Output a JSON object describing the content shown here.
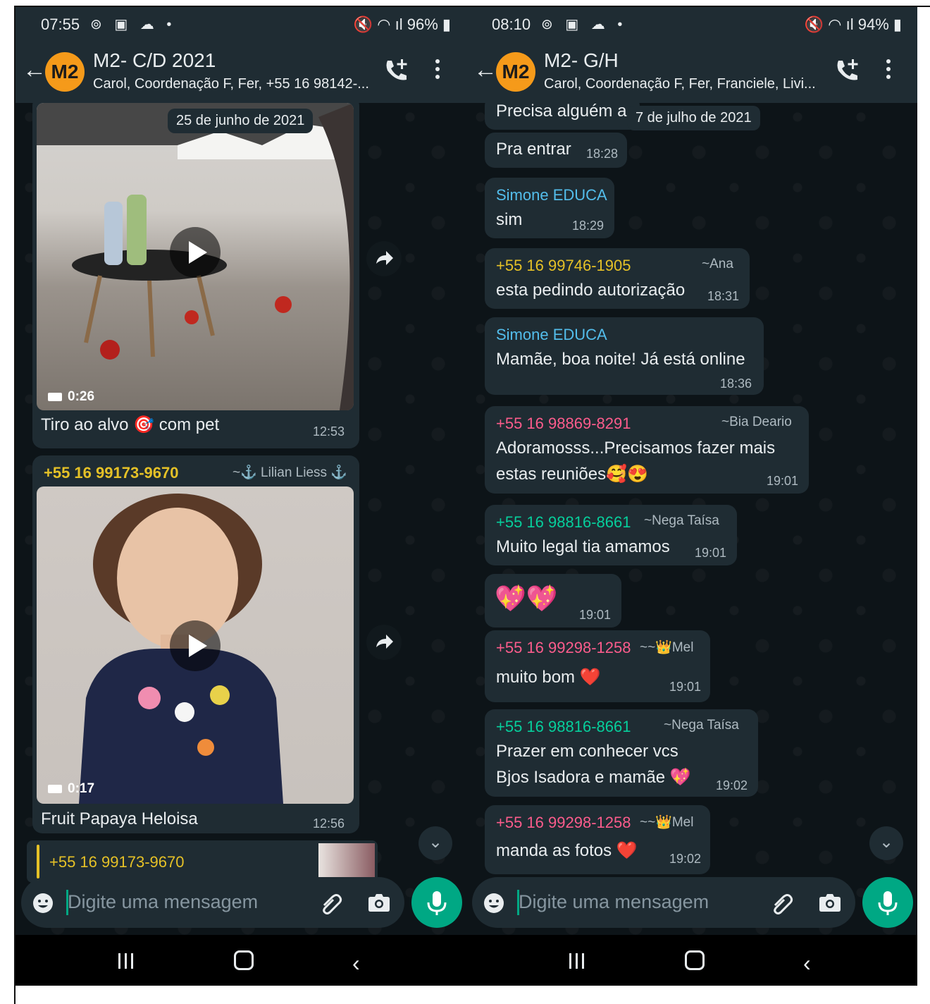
{
  "left": {
    "status": {
      "time": "07:55",
      "battery": "96%"
    },
    "header": {
      "title": "M2- C/D 2021",
      "subtitle": "Carol, Coordenação F, Fer, +55 16 98142-...",
      "avatar": "M2"
    },
    "date_chip": "25 de junho de 2021",
    "video1": {
      "duration": "0:26",
      "caption_a": "Tiro ao alvo",
      "caption_b": "com pet",
      "time": "12:53"
    },
    "video2": {
      "sender": "+55 16 99173-9670",
      "alias": "~⚓ Lilian Liess ⚓",
      "duration": "0:17",
      "caption": "Fruit Papaya Heloisa",
      "time": "12:56"
    },
    "quote": {
      "sender": "+55 16 99173-9670"
    },
    "input": {
      "placeholder": "Digite uma mensagem"
    }
  },
  "right": {
    "status": {
      "time": "08:10",
      "battery": "94%"
    },
    "header": {
      "title": "M2- G/H",
      "subtitle": "Carol, Coordenação F, Fer, Franciele, Livi...",
      "avatar": "M2"
    },
    "date_chip": "7 de julho de 2021",
    "messages": [
      {
        "text": "Precisa alguém a"
      },
      {
        "text": "Pra entrar",
        "time": "18:28"
      },
      {
        "sender": "Simone EDUCA",
        "text": "sim",
        "time": "18:29"
      },
      {
        "sender": "+55 16 99746-1905",
        "alias": "~Ana",
        "text": "esta pedindo autorização",
        "time": "18:31"
      },
      {
        "sender": "Simone EDUCA",
        "text": "Mamãe, boa noite! Já está online",
        "time": "18:36"
      },
      {
        "sender": "+55 16 98869-8291",
        "alias": "~Bia Deario",
        "text": "Adoramosss...Precisamos fazer mais",
        "text2": "estas reuniões🥰😍",
        "time": "19:01"
      },
      {
        "sender": "+55 16 98816-8661",
        "alias": "~Nega Taísa",
        "text": "Muito legal tia amamos",
        "time": "19:01"
      },
      {
        "text": "💖💖",
        "time": "19:01"
      },
      {
        "sender": "+55 16 99298-1258",
        "alias": "~~👑Mel",
        "text": "muito bom ❤️",
        "time": "19:01"
      },
      {
        "sender": "+55 16 98816-8661",
        "alias": "~Nega Taísa",
        "text": "Prazer em conhecer vcs",
        "text2": "Bjos Isadora e mamãe 💖",
        "time": "19:02"
      },
      {
        "sender": "+55 16 99298-1258",
        "alias": "~~👑Mel",
        "text": "manda as fotos ❤️",
        "time": "19:02"
      }
    ],
    "input": {
      "placeholder": "Digite uma mensagem"
    }
  },
  "icons": [
    "back-arrow-icon",
    "add-call-icon",
    "more-vertical-icon",
    "forward-icon",
    "play-icon",
    "video-camera-icon",
    "emoji-icon",
    "attach-icon",
    "camera-icon",
    "mic-icon",
    "chevron-down-icon"
  ],
  "colors": {
    "accent": "#00a884",
    "bubble": "#1f2c33",
    "header": "#1f2c33",
    "avatar": "#f59a1a"
  }
}
